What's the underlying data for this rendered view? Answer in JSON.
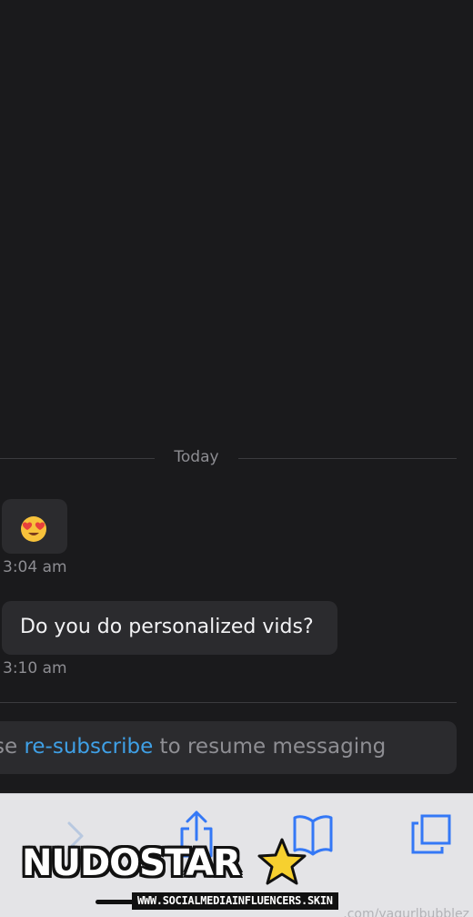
{
  "chat": {
    "date_separator": "Today",
    "messages": [
      {
        "type": "emoji",
        "content": "😍",
        "time": "3:04 am"
      },
      {
        "type": "text",
        "content": "Do you do personalized vids?",
        "time": "3:10 am"
      }
    ],
    "notice": {
      "prefix": "se ",
      "link": "re-subscribe",
      "suffix": " to resume messaging"
    }
  },
  "toolbar": {
    "icons": [
      "forward-icon",
      "share-icon",
      "bookmarks-icon",
      "tabs-icon"
    ]
  },
  "watermark": {
    "logo": "NUDOSTAR",
    "site": "WWW.SOCIALMEDIAINFLUENCERS.SKIN",
    "url_fragment": ".com/yagurlbubblez"
  },
  "colors": {
    "background": "#1a1a1c",
    "bubble": "#2b2b2e",
    "link": "#3fa0e6",
    "toolbar": "#e4e4e7",
    "toolbar_icon": "#3478f6"
  }
}
